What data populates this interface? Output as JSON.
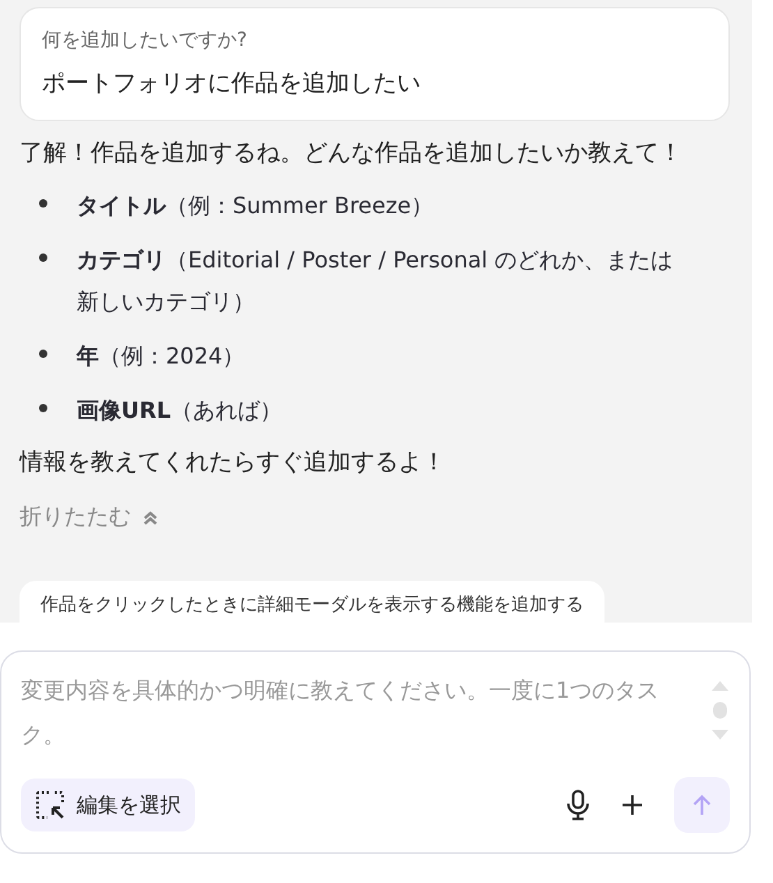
{
  "question_card": {
    "label": "何を追加したいですか?",
    "answer": "ポートフォリオに作品を追加したい"
  },
  "reply": {
    "intro": "了解！作品を追加するね。どんな作品を追加したいか教えて！",
    "items": [
      "**タイトル**（例：Summer Breeze）",
      "**カテゴリ**（Editorial / Poster / Personal のどれか、または新しいカテゴリ）",
      "**年**（例：2024）",
      "**画像URL**（あれば）"
    ],
    "outro": "情報を教えてくれたらすぐ追加するよ！"
  },
  "collapse": {
    "label": "折りたたむ",
    "expanded": true
  },
  "suggestion": "作品をクリックしたときに詳細モーダルを表示する機能を追加する",
  "composer": {
    "placeholder": "変更内容を具体的かつ明確に教えてください。一度に1つのタスク。",
    "select_button": "編集を選択",
    "send_disabled": true
  }
}
